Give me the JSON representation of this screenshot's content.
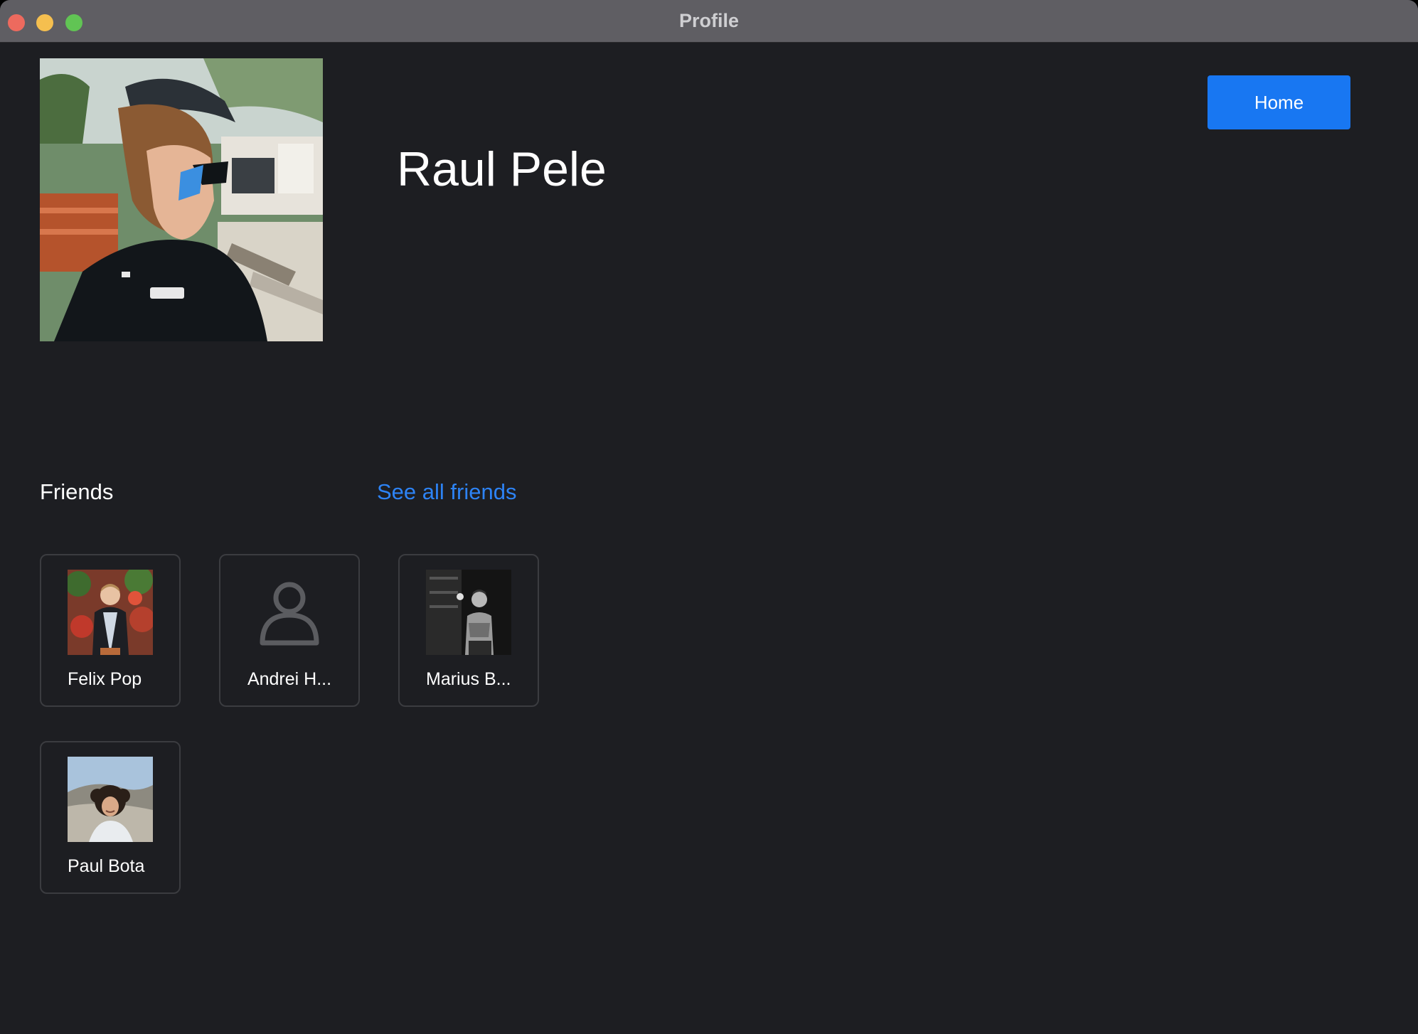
{
  "window": {
    "title": "Profile"
  },
  "profile": {
    "name": "Raul Pele"
  },
  "header": {
    "home_label": "Home"
  },
  "friends": {
    "heading": "Friends",
    "see_all_label": "See all friends",
    "items": [
      {
        "name": "Felix Pop",
        "photo": "photo"
      },
      {
        "name": "Andrei H...",
        "photo": "person-placeholder-icon"
      },
      {
        "name": "Marius B...",
        "photo": "photo"
      },
      {
        "name": "Paul Bota",
        "photo": "photo"
      }
    ]
  },
  "colors": {
    "background": "#1d1e22",
    "titlebar": "#5f5e63",
    "accent": "#1877f2",
    "link": "#2d83f5",
    "card_border": "#3b3c40"
  }
}
